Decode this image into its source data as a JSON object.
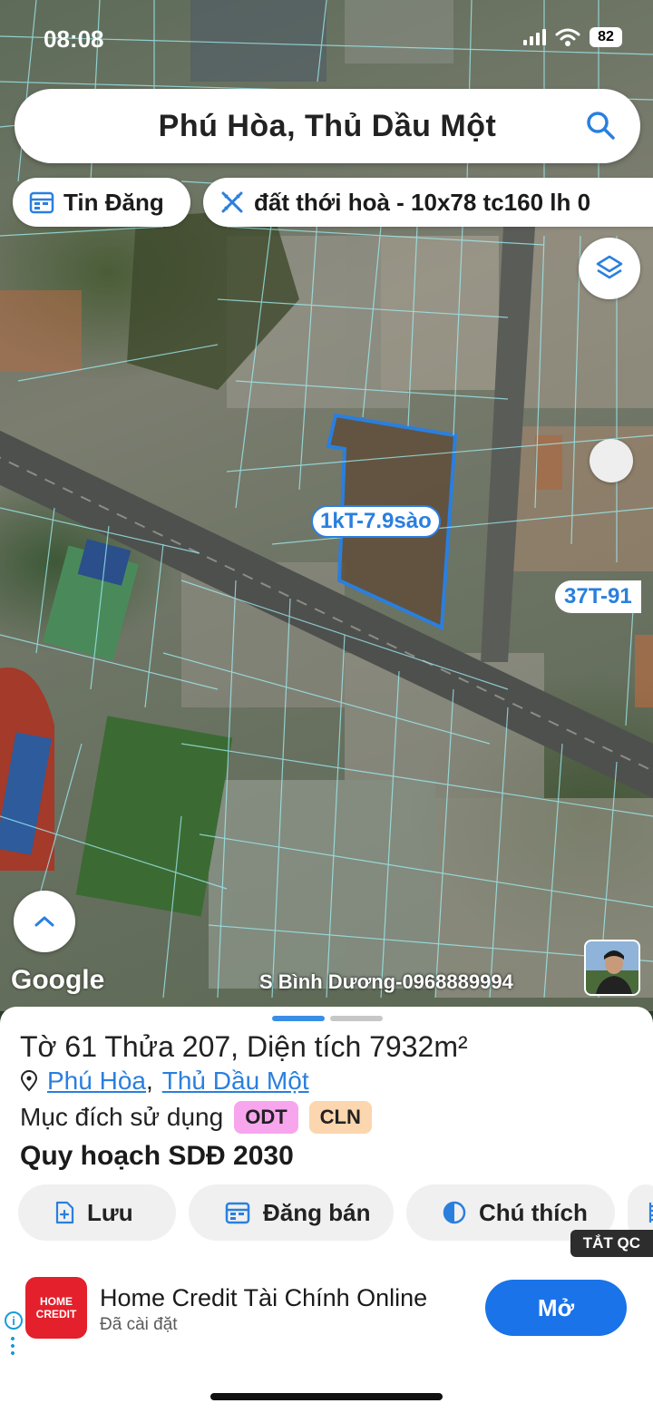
{
  "status_bar": {
    "time": "08:08",
    "battery": "82"
  },
  "search": {
    "title": "Phú Hòa, Thủ Dầu Một"
  },
  "chips": {
    "news": "Tin Đăng",
    "listing": "đất thới hoà - 10x78 tc160 lh 0"
  },
  "map": {
    "parcel_label": "1kT-7.9sào",
    "parcel_label_2": "37T-91",
    "google": "Google",
    "watermark": "S Bình Dương-0968889994",
    "parcel_outline_color": "#2a7fde"
  },
  "parcel": {
    "title": "Tờ 61 Thửa 207, Diện tích 7932m²",
    "ward": "Phú Hòa",
    "separator": ",",
    "city": "Thủ Dầu Một",
    "usage_label": "Mục đích sử dụng",
    "badges": [
      "ODT",
      "CLN"
    ],
    "plan_title": "Quy hoạch SDĐ 2030"
  },
  "actions": {
    "save": "Lưu",
    "post_sale": "Đăng bán",
    "legend": "Chú thích"
  },
  "ad": {
    "close_label": "TẮT QC",
    "logo_text": "HOME CREDIT",
    "title": "Home Credit Tài Chính Online",
    "subtitle": "Đã cài đặt",
    "open_button": "Mở",
    "info_glyph": "i"
  }
}
